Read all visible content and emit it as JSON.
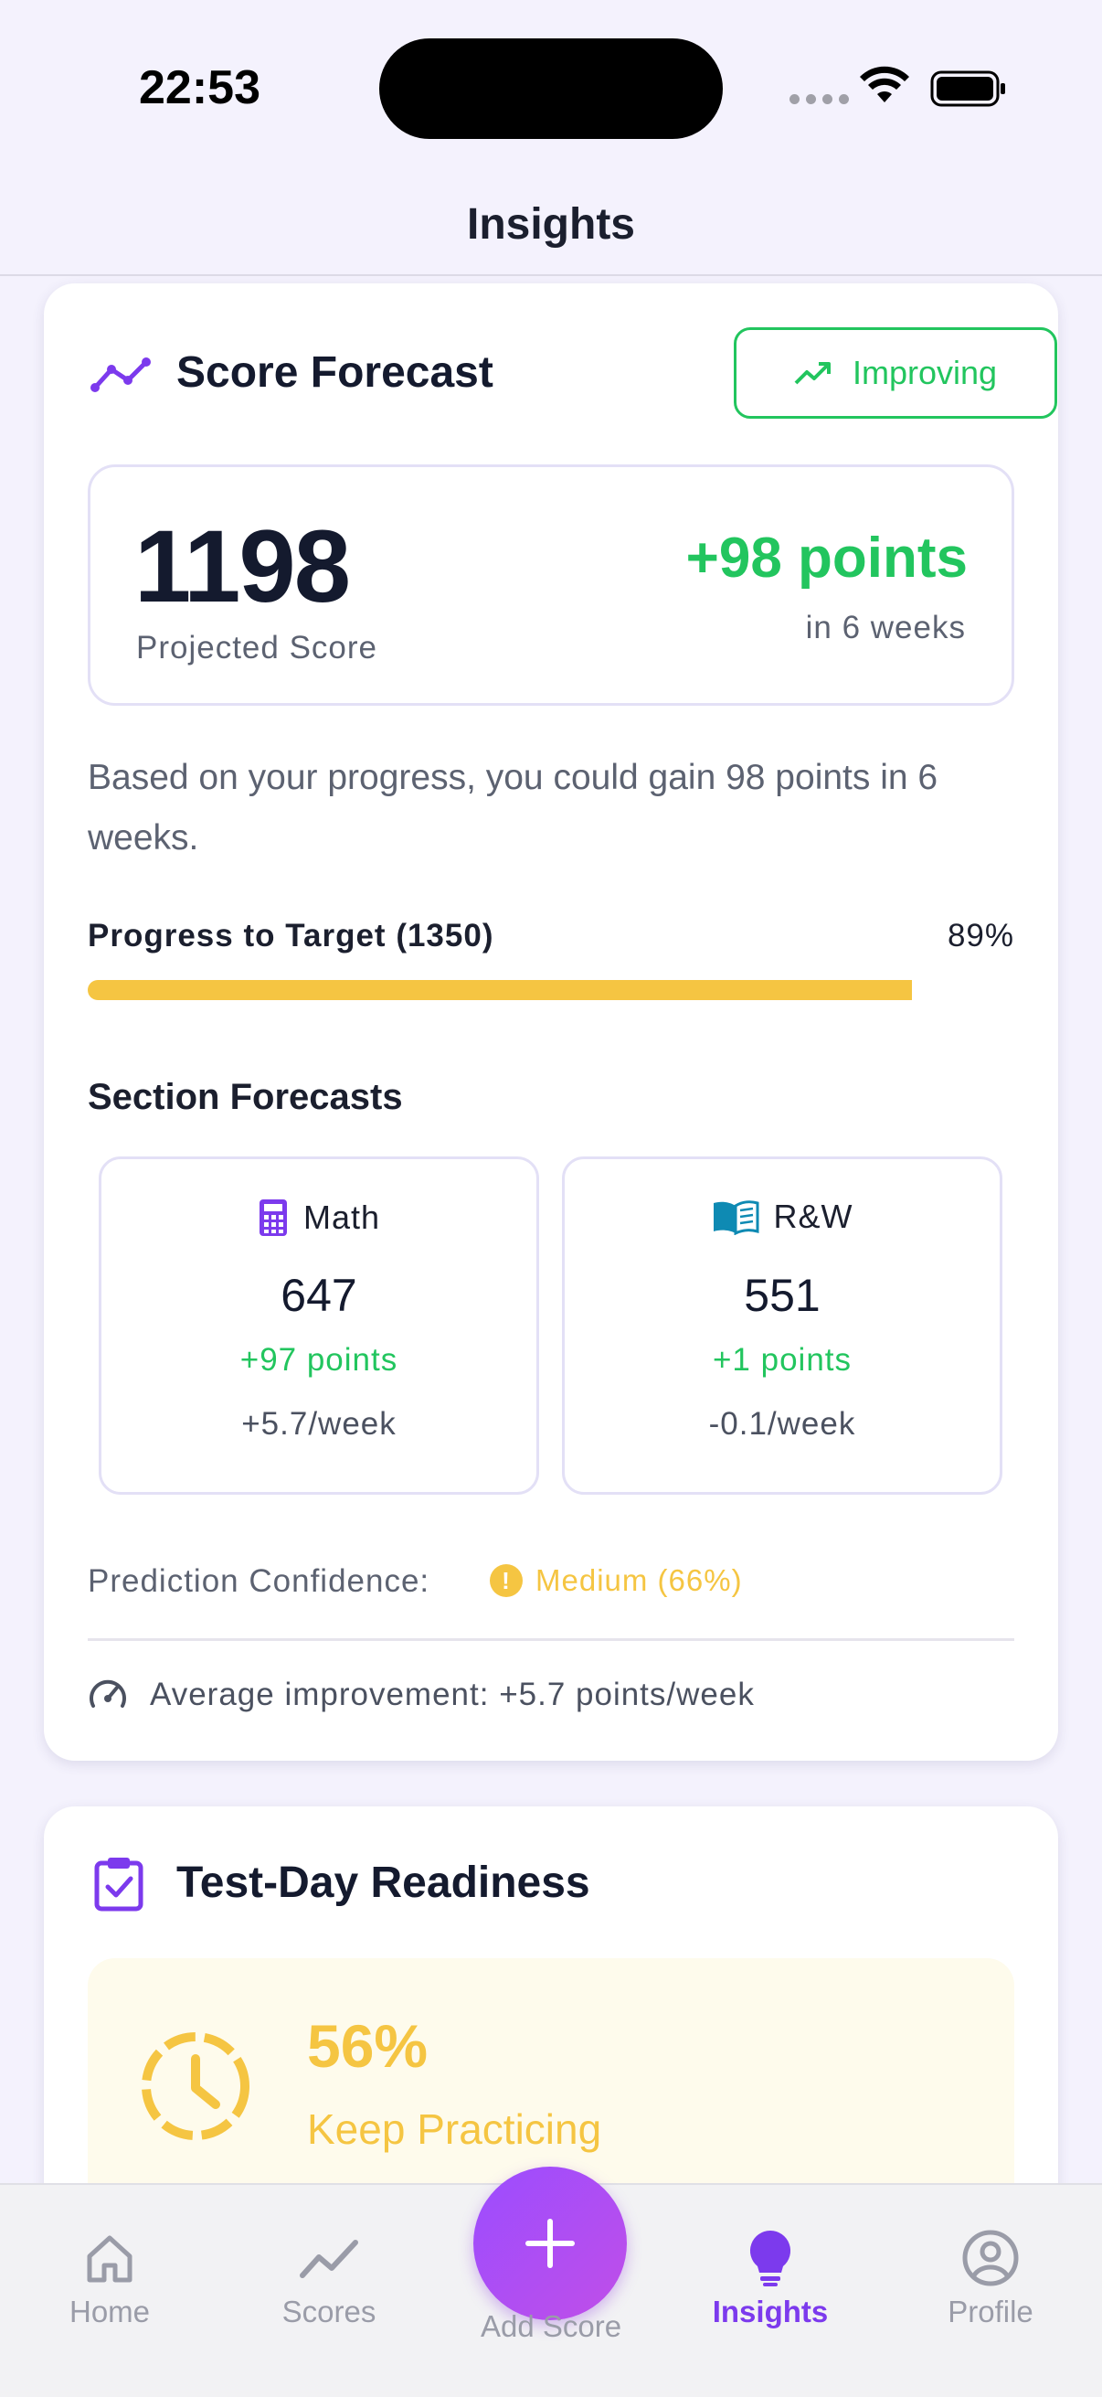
{
  "status_bar": {
    "time": "22:53"
  },
  "header": {
    "title": "Insights"
  },
  "forecast": {
    "title": "Score Forecast",
    "trend_badge": "Improving",
    "projected_score": "1198",
    "projected_label": "Projected Score",
    "points_gain": "+98 points",
    "gain_period": "in 6 weeks",
    "description": "Based on your progress, you could gain 98 points in 6 weeks.",
    "progress": {
      "label": "Progress to Target (1350)",
      "percent_text": "89%",
      "value": 0.89
    },
    "sections_title": "Section Forecasts",
    "sections": [
      {
        "name": "Math",
        "score": "647",
        "gain": "+97 points",
        "rate": "+5.7/week"
      },
      {
        "name": "R&W",
        "score": "551",
        "gain": "+1 points",
        "rate": "-0.1/week"
      }
    ],
    "confidence_label": "Prediction Confidence:",
    "confidence_value": "Medium (66%)",
    "average_improvement": "Average improvement: +5.7 points/week"
  },
  "readiness": {
    "title": "Test-Day Readiness",
    "percent": "56%",
    "message": "Keep Practicing"
  },
  "tab_bar": {
    "home": "Home",
    "scores": "Scores",
    "add_score": "Add Score",
    "insights": "Insights",
    "profile": "Profile"
  },
  "colors": {
    "accent": "#7c3aed",
    "success": "#22c55e",
    "warning": "#f5c542",
    "background": "#f4f2fd"
  }
}
